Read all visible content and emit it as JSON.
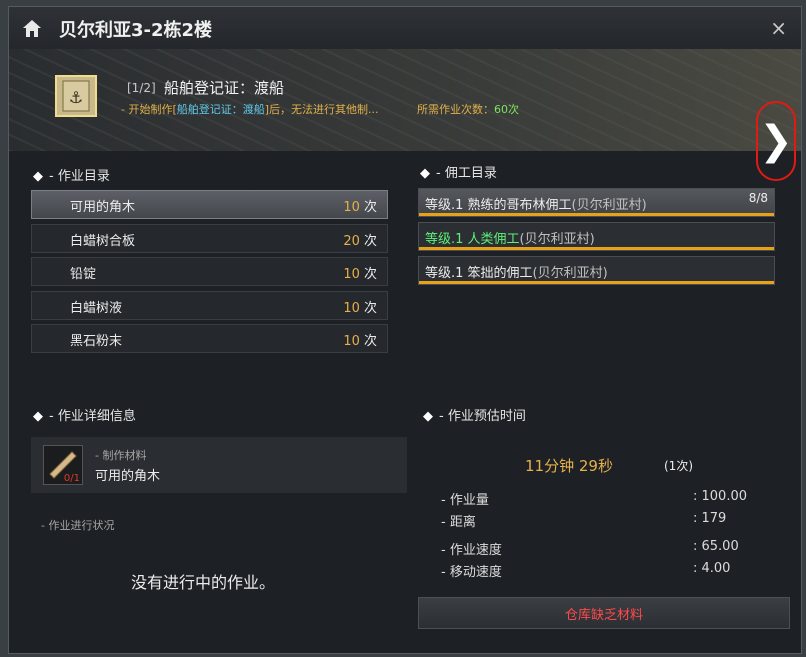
{
  "window": {
    "title": "贝尔利亚3-2栋2楼",
    "close_label": "×"
  },
  "header": {
    "count": "[1/2]",
    "item_title": "船舶登记证：渡船",
    "warning_prefix": "- 开始制作[",
    "warning_item": "船舶登记证：渡船",
    "warning_suffix": "]后，无法进行其他制...",
    "required_label": "所需作业次数：",
    "required_value": "60次",
    "next_label": "❯"
  },
  "task_list": {
    "title": "- 作业目录",
    "items": [
      {
        "name": "可用的角木",
        "count": "10",
        "unit": " 次",
        "selected": true
      },
      {
        "name": "白蜡树合板",
        "count": "20",
        "unit": " 次",
        "selected": false
      },
      {
        "name": "铅锭",
        "count": "10",
        "unit": " 次",
        "selected": false
      },
      {
        "name": "白蜡树液",
        "count": "10",
        "unit": " 次",
        "selected": false
      },
      {
        "name": "黑石粉末",
        "count": "10",
        "unit": " 次",
        "selected": false
      }
    ]
  },
  "worker_list": {
    "title": "- 佣工目录",
    "items": [
      {
        "name": "等级.1 熟练的哥布林佣工",
        "village": "(贝尔利亚村)",
        "capacity": "8/8",
        "green": false
      },
      {
        "name": "等级.1 人类佣工",
        "village": "(贝尔利亚村)",
        "capacity": "",
        "green": true
      },
      {
        "name": "等级.1 笨拙的佣工",
        "village": "(贝尔利亚村)",
        "capacity": "",
        "green": false
      }
    ]
  },
  "details": {
    "title": "- 作业详细信息",
    "material_label": "- 制作材料",
    "material_name": "可用的角木",
    "material_count": "0/1",
    "status_label": "- 作业进行状况",
    "no_task": "没有进行中的作业。"
  },
  "estimate": {
    "title": "- 作业预估时间",
    "time": "11分钟 29秒",
    "times": "(1次)",
    "stats": [
      {
        "label": "- 作业量",
        "value": ": 100.00"
      },
      {
        "label": "- 距离",
        "value": ": 179"
      },
      {
        "label": "- 作业速度",
        "value": ": 65.00"
      },
      {
        "label": "- 移动速度",
        "value": ": 4.00"
      }
    ],
    "button": "仓库缺乏材料"
  }
}
